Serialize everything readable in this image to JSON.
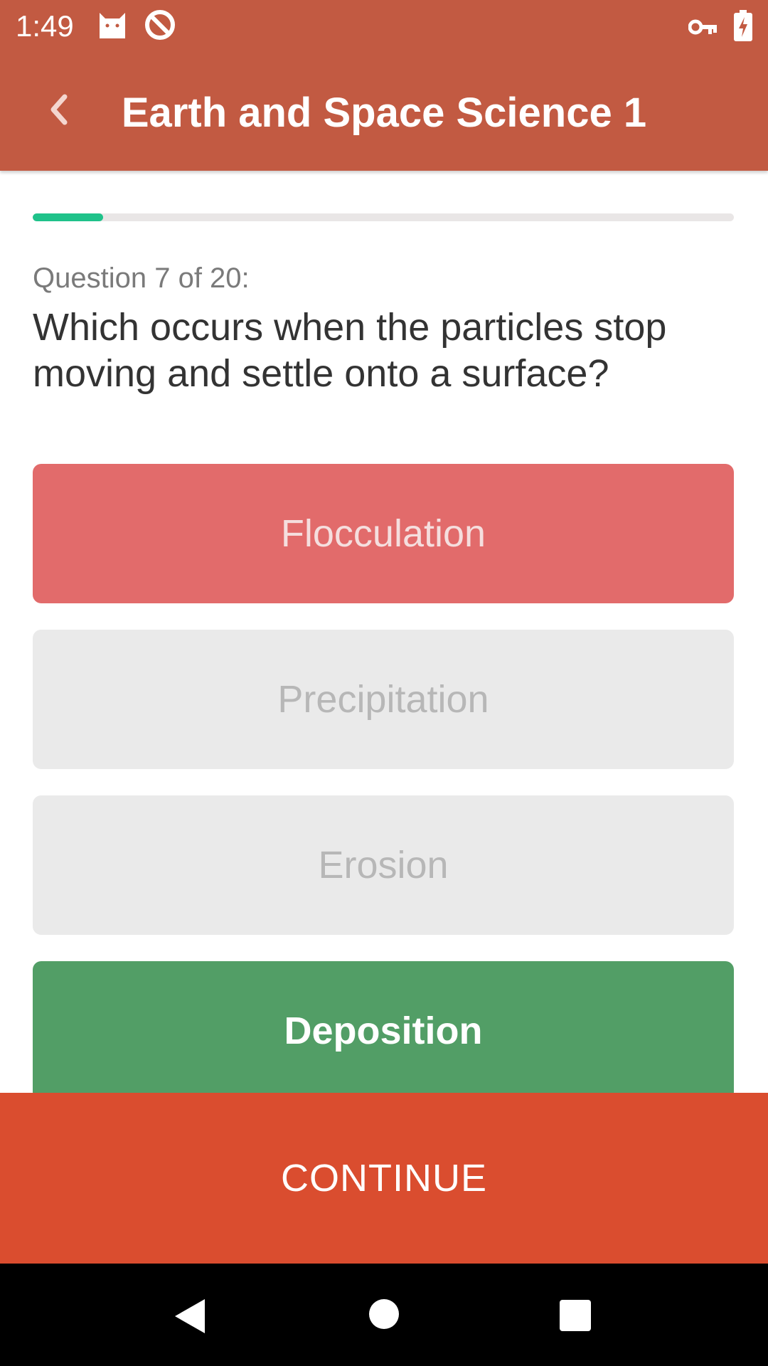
{
  "status_bar": {
    "time": "1:49",
    "icons_left": [
      "cat-icon",
      "blocked-circle-icon"
    ],
    "icons_right": [
      "vpn-key-icon",
      "battery-charging-icon"
    ]
  },
  "app_bar": {
    "back_icon": "chevron-left-icon",
    "title": "Earth and Space Science 1"
  },
  "quiz": {
    "progress_fraction": 0.1,
    "question_label": "Question 7 of 20:",
    "question_text": "Which occurs when the particles stop moving and settle onto a surface?",
    "answers": [
      {
        "label": "Flocculation",
        "state": "wrong"
      },
      {
        "label": "Precipitation",
        "state": "neutral"
      },
      {
        "label": "Erosion",
        "state": "neutral"
      },
      {
        "label": "Deposition",
        "state": "correct"
      }
    ]
  },
  "continue_button": {
    "label": "CONTINUE"
  },
  "nav_bar": {
    "icons": [
      "back-triangle-icon",
      "home-circle-icon",
      "recents-square-icon"
    ]
  },
  "colors": {
    "app_bar": "#c25a42",
    "progress": "#1fc28a",
    "wrong": "#e26b6b",
    "correct": "#529e66",
    "neutral": "#eaeaea",
    "continue": "#da4d2f"
  }
}
